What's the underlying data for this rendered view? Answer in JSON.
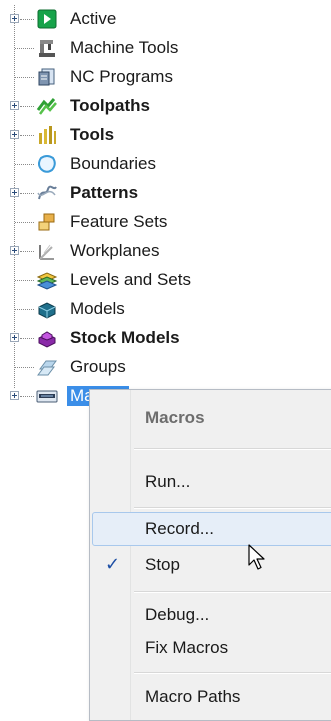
{
  "tree": {
    "items": [
      {
        "label": "Active",
        "icon": "active-arrow-icon",
        "expandable": true,
        "bold": false
      },
      {
        "label": "Machine Tools",
        "icon": "machine-tool-icon",
        "expandable": false,
        "bold": false
      },
      {
        "label": "NC Programs",
        "icon": "nc-program-icon",
        "expandable": false,
        "bold": false
      },
      {
        "label": "Toolpaths",
        "icon": "toolpath-icon",
        "expandable": true,
        "bold": true
      },
      {
        "label": "Tools",
        "icon": "tools-icon",
        "expandable": true,
        "bold": true
      },
      {
        "label": "Boundaries",
        "icon": "boundary-icon",
        "expandable": false,
        "bold": false
      },
      {
        "label": "Patterns",
        "icon": "pattern-icon",
        "expandable": true,
        "bold": true
      },
      {
        "label": "Feature Sets",
        "icon": "feature-set-icon",
        "expandable": false,
        "bold": false
      },
      {
        "label": "Workplanes",
        "icon": "workplane-icon",
        "expandable": true,
        "bold": false
      },
      {
        "label": "Levels and Sets",
        "icon": "levels-icon",
        "expandable": false,
        "bold": false
      },
      {
        "label": "Models",
        "icon": "model-icon",
        "expandable": false,
        "bold": false
      },
      {
        "label": "Stock Models",
        "icon": "stock-model-icon",
        "expandable": true,
        "bold": true
      },
      {
        "label": "Groups",
        "icon": "group-icon",
        "expandable": false,
        "bold": false
      },
      {
        "label": "Macros",
        "icon": "macro-icon",
        "expandable": true,
        "bold": false,
        "selected": true
      }
    ]
  },
  "context_menu": {
    "header": "Macros",
    "run": "Run...",
    "record": "Record...",
    "stop": "Stop",
    "stop_checked": true,
    "check_glyph": "✓",
    "debug": "Debug...",
    "fix_macros": "Fix Macros",
    "macro_paths": "Macro Paths"
  },
  "colors": {
    "selection": "#3b8ee8",
    "hover_bg": "#e6eef8",
    "hover_border": "#a8c8ec",
    "check": "#1d4fa5"
  }
}
